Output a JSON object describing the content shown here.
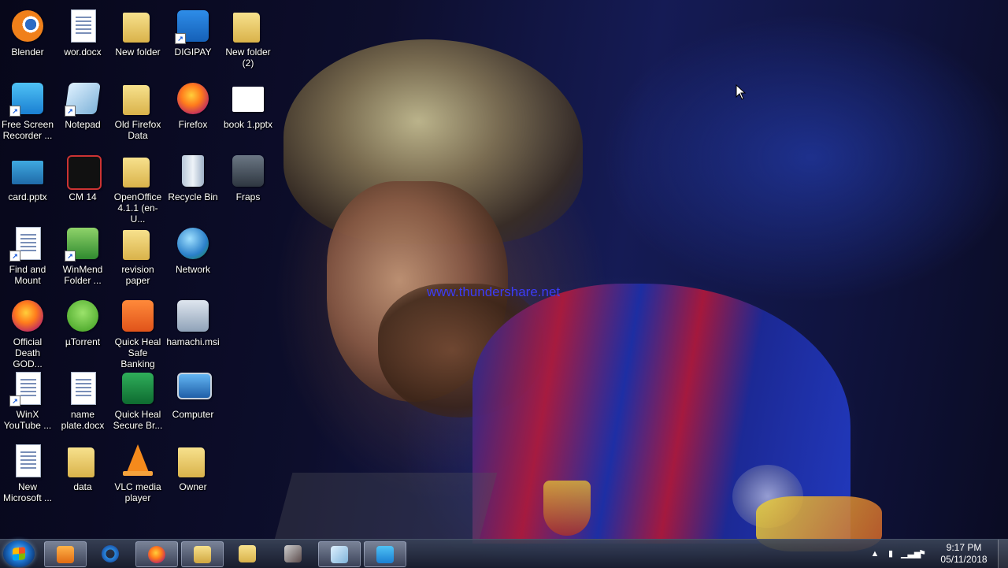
{
  "wallpaper": {
    "watermark": "www.thundershare.net"
  },
  "icons": [
    {
      "label": "Blender",
      "icon": "blender-icon"
    },
    {
      "label": "wor.docx",
      "icon": "word-document-icon"
    },
    {
      "label": "New folder",
      "icon": "folder-icon"
    },
    {
      "label": "DIGIPAY",
      "icon": "digipay-icon"
    },
    {
      "label": "New folder (2)",
      "icon": "folder-icon"
    },
    {
      "label": "Free Screen Recorder ...",
      "icon": "screen-recorder-icon"
    },
    {
      "label": "Notepad",
      "icon": "notepad-icon"
    },
    {
      "label": "Old Firefox Data",
      "icon": "folder-icon"
    },
    {
      "label": "Firefox",
      "icon": "firefox-icon"
    },
    {
      "label": "book 1.pptx",
      "icon": "presentation-icon"
    },
    {
      "label": "card.pptx",
      "icon": "presentation-icon"
    },
    {
      "label": "CM 14",
      "icon": "cm14-icon"
    },
    {
      "label": "OpenOffice 4.1.1 (en-U...",
      "icon": "folder-icon"
    },
    {
      "label": "Recycle Bin",
      "icon": "recycle-bin-icon"
    },
    {
      "label": "Fraps",
      "icon": "fraps-icon"
    },
    {
      "label": "Find and Mount",
      "icon": "find-and-mount-icon"
    },
    {
      "label": "WinMend Folder ...",
      "icon": "winmend-icon"
    },
    {
      "label": "revision paper",
      "icon": "folder-icon"
    },
    {
      "label": "Network",
      "icon": "network-icon"
    },
    {
      "label": "Official Death GOD...",
      "icon": "firefox-document-icon"
    },
    {
      "label": "µTorrent",
      "icon": "utorrent-icon"
    },
    {
      "label": "Quick Heal Safe Banking",
      "icon": "quick-heal-banking-icon"
    },
    {
      "label": "hamachi.msi",
      "icon": "installer-icon"
    },
    {
      "label": "WinX YouTube ...",
      "icon": "winx-youtube-icon"
    },
    {
      "label": "name plate.docx",
      "icon": "word-document-icon"
    },
    {
      "label": "Quick Heal Secure Br...",
      "icon": "quick-heal-browser-icon"
    },
    {
      "label": "Computer",
      "icon": "computer-icon"
    },
    {
      "label": "New Microsoft ...",
      "icon": "word-document-icon"
    },
    {
      "label": "data",
      "icon": "folder-icon"
    },
    {
      "label": "VLC media player",
      "icon": "vlc-icon"
    },
    {
      "label": "Owner",
      "icon": "user-folder-icon"
    }
  ],
  "taskbar": {
    "buttons": [
      {
        "icon": "start-orb-icon"
      },
      {
        "icon": "media-player-icon"
      },
      {
        "icon": "internet-explorer-icon"
      },
      {
        "icon": "firefox-icon"
      },
      {
        "icon": "file-explorer-icon"
      },
      {
        "icon": "folder-icon"
      },
      {
        "icon": "game-icon"
      },
      {
        "icon": "notepad-icon"
      },
      {
        "icon": "screen-recorder-icon"
      }
    ],
    "tray": {
      "time": "9:17 PM",
      "date": "05/11/2018",
      "icons": [
        "show-hidden-icons-arrow",
        "usb-device-icon",
        "network-signal-icon",
        "action-center-flag-icon"
      ]
    }
  },
  "colors": {
    "taskbar": "#232a3a",
    "watermark": "#3c3cf5",
    "label_text": "#ffffff"
  }
}
